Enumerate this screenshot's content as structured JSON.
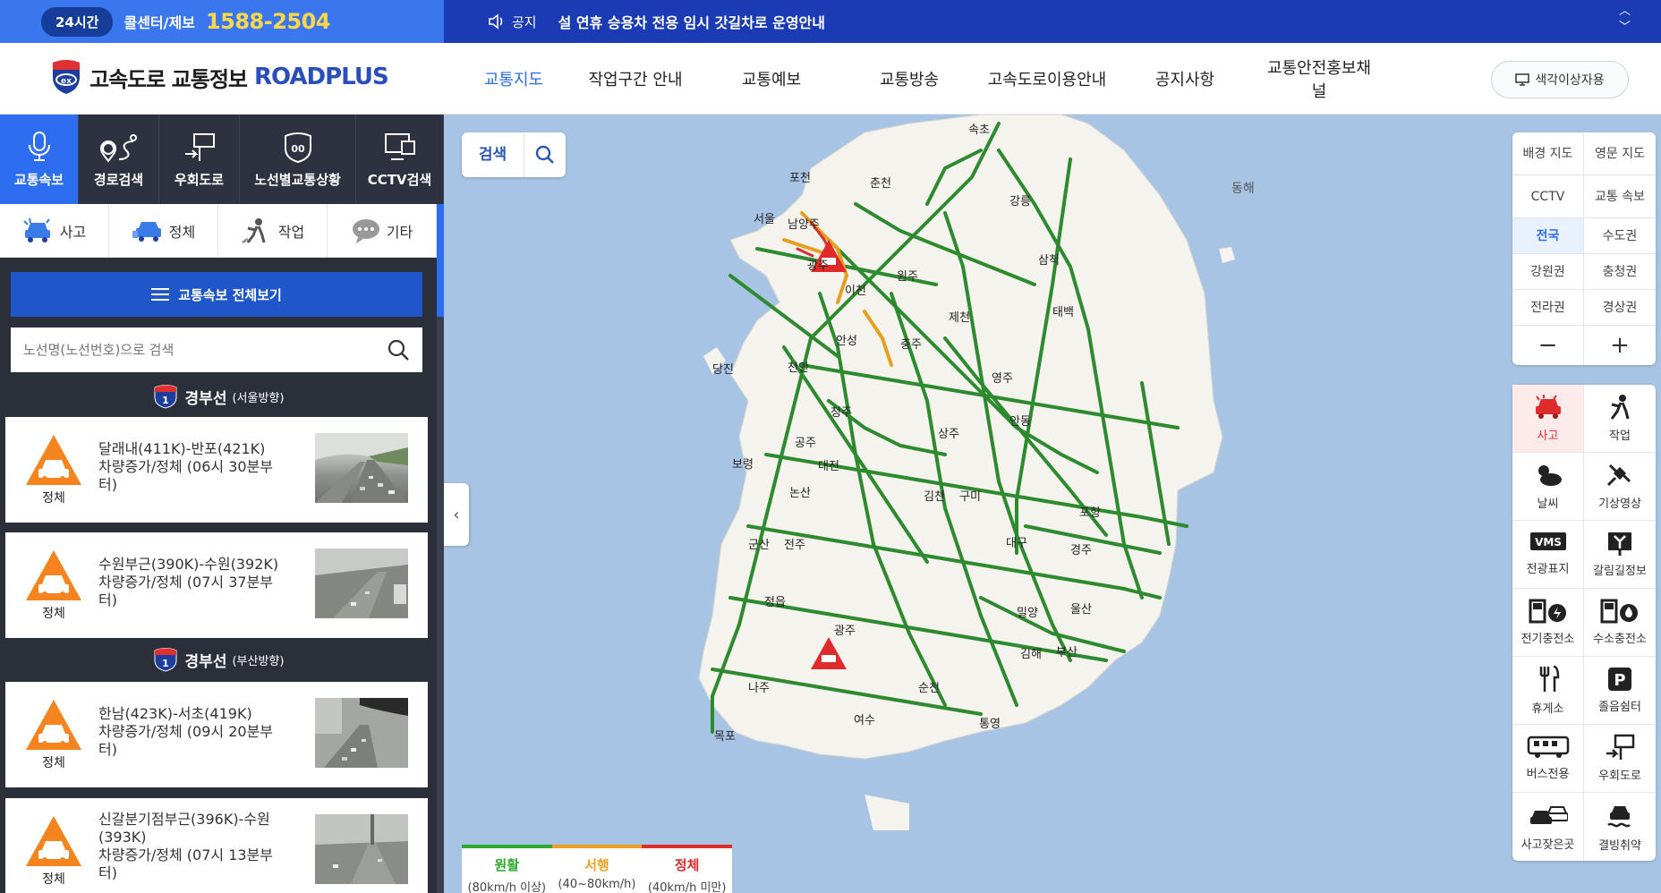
{
  "topbar": {
    "badge": "24시간",
    "callcenter": "콜센터/제보",
    "phone": "1588-2504",
    "notice_label": "공지",
    "notice_text": "설 연휴 승용차 전용 임시 갓길차로 운영안내"
  },
  "header": {
    "logo_title": "고속도로 교통정보",
    "logo_brand": "ROADPLUS",
    "nav": [
      "교통지도",
      "작업구간 안내",
      "교통예보",
      "교통방송",
      "고속도로이용안내",
      "공지사항",
      "교통안전홍보채널"
    ],
    "colorblind": "색각이상자용"
  },
  "left": {
    "tabs": [
      "교통속보",
      "경로검색",
      "우회도로",
      "노선별교통상황",
      "CCTV검색"
    ],
    "categories": [
      "사고",
      "정체",
      "작업",
      "기타"
    ],
    "view_all": "교통속보 전체보기",
    "search_placeholder": "노선명(노선번호)으로 검색",
    "routes": [
      {
        "number": "1",
        "name": "경부선",
        "direction": "(서울방향)"
      },
      {
        "number": "1",
        "name": "경부선",
        "direction": "(부산방향)"
      }
    ],
    "cards": [
      {
        "line1": "달래내(411K)-반포(421K)",
        "line2": "차량증가/정체 (06시 30분부",
        "line3": "터)",
        "status": "정체"
      },
      {
        "line1": "수원부근(390K)-수원(392K)",
        "line2": "차량증가/정체 (07시 37분부",
        "line3": "터)",
        "status": "정체"
      },
      {
        "line1": "한남(423K)-서초(419K)",
        "line2": "차량증가/정체 (09시 20분부",
        "line3": "터)",
        "status": "정체"
      },
      {
        "line1": "신갈분기점부근(396K)-수원",
        "line2": "(393K)",
        "line3": "차량증가/정체 (07시 13분부",
        "line4": "터)",
        "status": "정체"
      }
    ]
  },
  "map": {
    "search_label": "검색",
    "sea_label": "동해",
    "cities": [
      "속초",
      "포천",
      "춘천",
      "강릉",
      "서울",
      "남양주",
      "광주",
      "원주",
      "이천",
      "삼척",
      "제천",
      "태백",
      "안성",
      "충주",
      "당진",
      "천안",
      "영주",
      "청주",
      "안동",
      "보령",
      "상주",
      "공주",
      "대전",
      "논산",
      "김천",
      "구미",
      "포항",
      "대구",
      "군산",
      "전주",
      "경주",
      "정읍",
      "밀양",
      "울산",
      "광주",
      "김해",
      "부산",
      "나주",
      "순천",
      "여수",
      "통영",
      "목포"
    ],
    "legend": [
      {
        "name": "원활",
        "range": "(80km/h 이상)",
        "color": "#2ea82e"
      },
      {
        "name": "서행",
        "range": "(40~80km/h)",
        "color": "#f0a020"
      },
      {
        "name": "정체",
        "range": "(40km/h 미만)",
        "color": "#e02b2b"
      }
    ],
    "controls": [
      [
        "배경 지도",
        "영문 지도"
      ],
      [
        "CCTV",
        "교통 속보"
      ],
      [
        "전국",
        "수도권"
      ],
      [
        "강원권",
        "충청권"
      ],
      [
        "전라권",
        "경상권"
      ]
    ],
    "zoom_out": "−",
    "zoom_in": "+",
    "layers": [
      [
        "사고",
        "작업"
      ],
      [
        "날씨",
        "기상영상"
      ],
      [
        "전광표지",
        "갈림길정보"
      ],
      [
        "전기충전소",
        "수소충전소"
      ],
      [
        "휴게소",
        "졸음쉼터"
      ],
      [
        "버스전용",
        "우회도로"
      ],
      [
        "사고잦은곳",
        "결빙취약"
      ]
    ],
    "vms": "VMS",
    "parking": "P"
  }
}
